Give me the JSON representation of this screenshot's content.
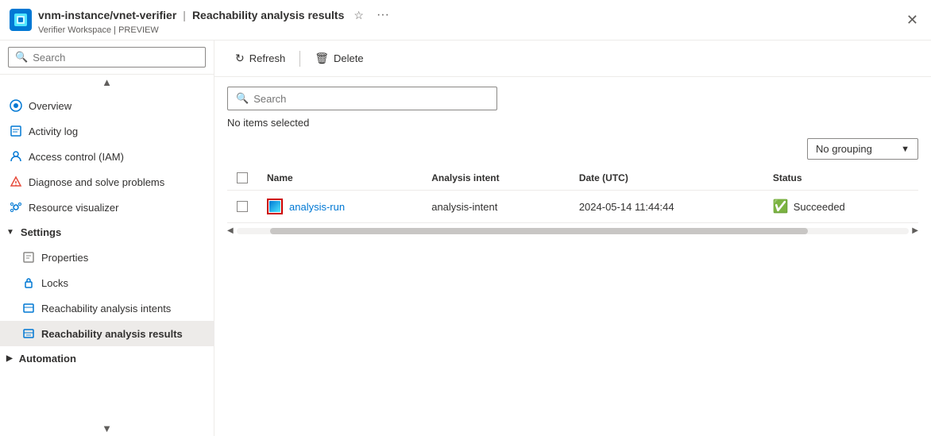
{
  "titlebar": {
    "title": "vnm-instance/vnet-verifier",
    "separator": "|",
    "page": "Reachability analysis results",
    "subtitle": "Verifier Workspace | PREVIEW"
  },
  "sidebar": {
    "search_placeholder": "Search",
    "nav_items": [
      {
        "id": "overview",
        "label": "Overview",
        "icon": "overview-icon",
        "indented": false,
        "active": false
      },
      {
        "id": "activity-log",
        "label": "Activity log",
        "icon": "activity-icon",
        "indented": false,
        "active": false
      },
      {
        "id": "access-control",
        "label": "Access control (IAM)",
        "icon": "iam-icon",
        "indented": false,
        "active": false
      },
      {
        "id": "diagnose",
        "label": "Diagnose and solve problems",
        "icon": "diagnose-icon",
        "indented": false,
        "active": false
      },
      {
        "id": "resource-visualizer",
        "label": "Resource visualizer",
        "icon": "visualizer-icon",
        "indented": false,
        "active": false
      },
      {
        "id": "settings",
        "label": "Settings",
        "icon": "settings-section",
        "indented": false,
        "active": false,
        "section": true
      },
      {
        "id": "properties",
        "label": "Properties",
        "icon": "properties-icon",
        "indented": true,
        "active": false
      },
      {
        "id": "locks",
        "label": "Locks",
        "icon": "locks-icon",
        "indented": true,
        "active": false
      },
      {
        "id": "reachability-intents",
        "label": "Reachability analysis intents",
        "icon": "intents-icon",
        "indented": true,
        "active": false
      },
      {
        "id": "reachability-results",
        "label": "Reachability analysis results",
        "icon": "results-icon",
        "indented": true,
        "active": true
      },
      {
        "id": "automation",
        "label": "Automation",
        "icon": "automation-icon",
        "indented": false,
        "active": false,
        "section": true
      }
    ]
  },
  "toolbar": {
    "refresh_label": "Refresh",
    "delete_label": "Delete"
  },
  "content": {
    "search_placeholder": "Search",
    "no_items_text": "No items selected",
    "grouping_label": "No grouping",
    "table": {
      "columns": [
        "Name",
        "Analysis intent",
        "Date (UTC)",
        "Status"
      ],
      "rows": [
        {
          "name": "analysis-run",
          "analysis_intent": "analysis-intent",
          "date_utc": "2024-05-14 11:44:44",
          "status": "Succeeded"
        }
      ]
    }
  }
}
